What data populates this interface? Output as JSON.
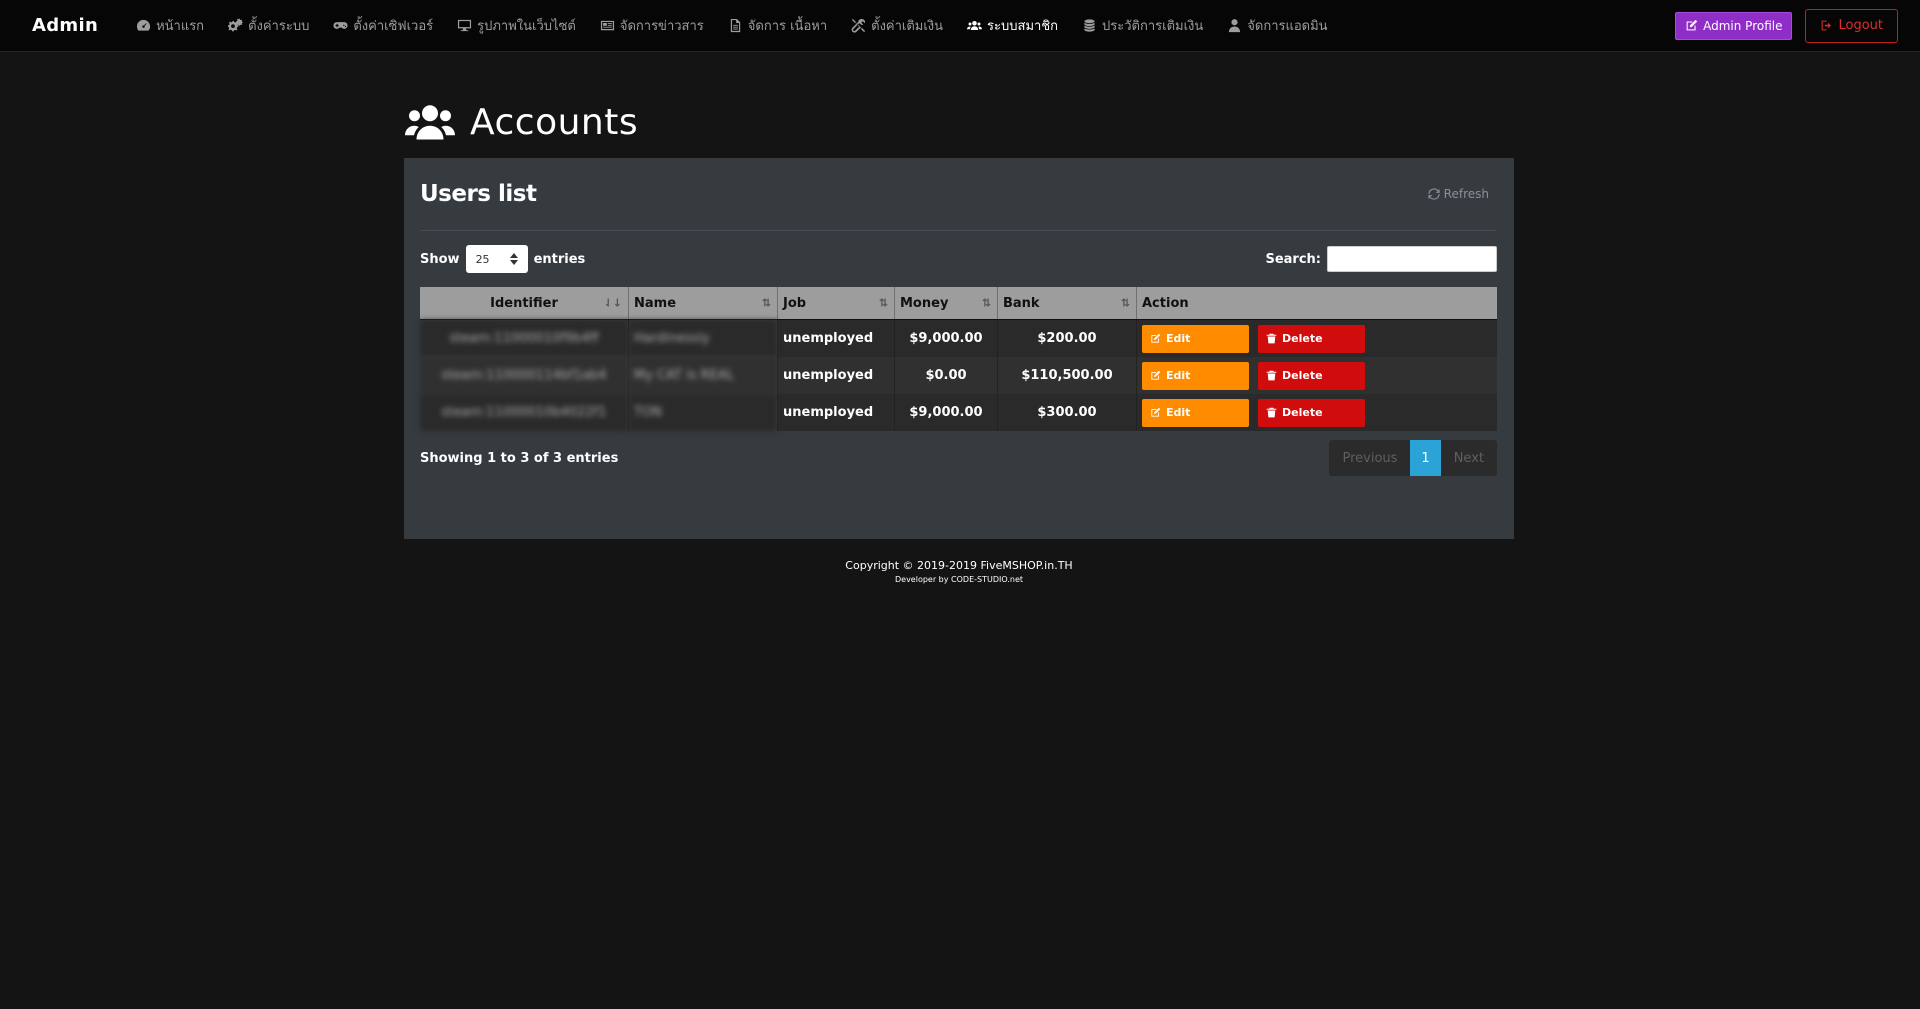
{
  "navbar": {
    "brand": "Admin",
    "items": [
      {
        "label": "หน้าแรก",
        "icon": "dashboard-icon"
      },
      {
        "label": "ตั้งค่าระบบ",
        "icon": "cogs-icon"
      },
      {
        "label": "ตั้งค่าเซิฟเวอร์",
        "icon": "gamepad-icon"
      },
      {
        "label": "รูปภาพในเว็บไซต์",
        "icon": "desktop-icon"
      },
      {
        "label": "จัดการข่าวสาร",
        "icon": "newspaper-icon"
      },
      {
        "label": "จัดการ เนื้อหา",
        "icon": "file-icon"
      },
      {
        "label": "ตั้งค่าเติมเงิน",
        "icon": "tools-icon"
      },
      {
        "label": "ระบบสมาชิก",
        "icon": "users-icon",
        "active": true
      },
      {
        "label": "ประวัติการเติมเงิน",
        "icon": "coins-icon"
      },
      {
        "label": "จัดการแอดมิน",
        "icon": "user-icon"
      }
    ],
    "profile_label": "Admin Profile",
    "logout_label": "Logout"
  },
  "page": {
    "title": "Accounts"
  },
  "panel": {
    "title": "Users list",
    "refresh_label": "Refresh",
    "show_label": "Show",
    "entries_value": "25",
    "entries_label": "entries",
    "search_label": "Search:",
    "search_value": ""
  },
  "table": {
    "columns": [
      "Identifier",
      "Name",
      "Job",
      "Money",
      "Bank",
      "Action"
    ],
    "rows": [
      {
        "identifier": "steam:11000010f9b4ff",
        "name": "Hardinessly",
        "job": "unemployed",
        "money": "$9,000.00",
        "bank": "$200.00"
      },
      {
        "identifier": "steam:110000114bf1ab4",
        "name": "My CAT is REAL",
        "job": "unemployed",
        "money": "$0.00",
        "bank": "$110,500.00"
      },
      {
        "identifier": "steam:11000010b4022f1",
        "name": "TON",
        "job": "unemployed",
        "money": "$9,000.00",
        "bank": "$300.00"
      }
    ],
    "edit_label": "Edit",
    "delete_label": "Delete"
  },
  "table_footer": {
    "info": "Showing 1 to 3 of 3 entries",
    "previous": "Previous",
    "page": "1",
    "next": "Next"
  },
  "footer": {
    "copyright": "Copyright © 2019-2019 FiveMSHOP.in.TH",
    "developer": "Developer by CODE-STUDIO.net"
  },
  "colors": {
    "profile_button": "#8e2ec7",
    "logout_button": "#c21e1e",
    "edit_button": "#ff8c00",
    "delete_button": "#d00c0c",
    "current_page": "#2ba3d7"
  }
}
